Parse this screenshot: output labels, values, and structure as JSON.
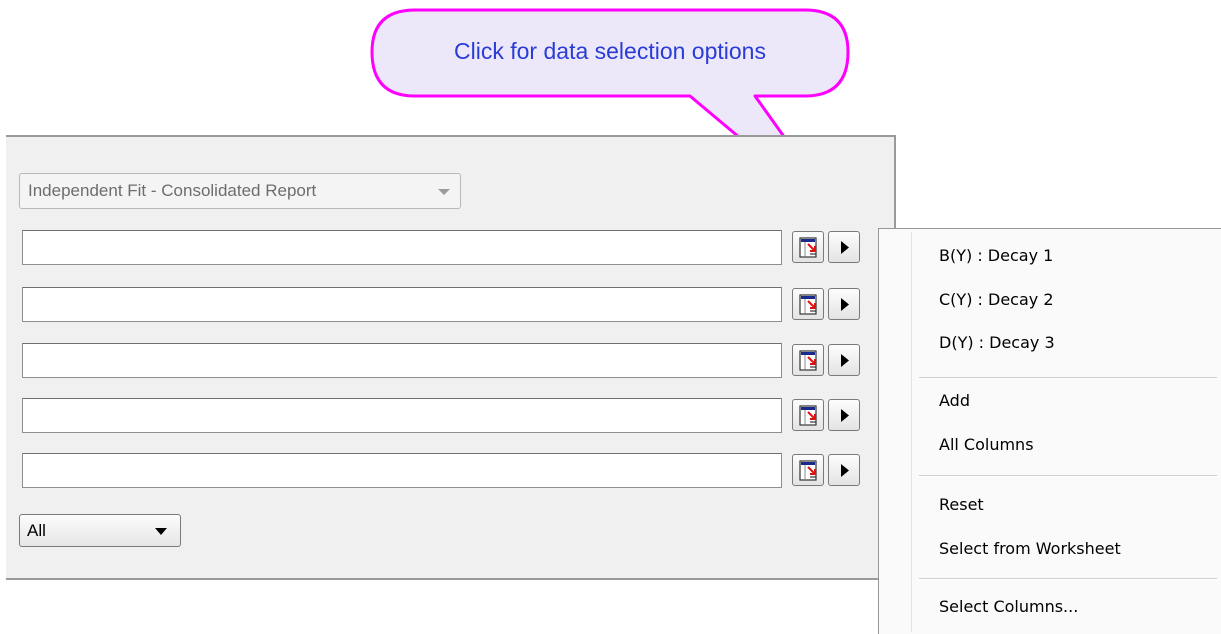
{
  "callout": {
    "text": "Click for data selection options",
    "outline_color": "#ff00ff",
    "text_color": "#2a3bd6"
  },
  "report_combo": {
    "value": "Independent Fit - Consolidated Report",
    "enabled": false
  },
  "data_rows": [
    {
      "value": "",
      "pick_icon": "worksheet-pick-icon",
      "menu_icon": "triangle-right-icon"
    },
    {
      "value": "",
      "pick_icon": "worksheet-pick-icon",
      "menu_icon": "triangle-right-icon"
    },
    {
      "value": "",
      "pick_icon": "worksheet-pick-icon",
      "menu_icon": "triangle-right-icon"
    },
    {
      "value": "",
      "pick_icon": "worksheet-pick-icon",
      "menu_icon": "triangle-right-icon"
    },
    {
      "value": "",
      "pick_icon": "worksheet-pick-icon",
      "menu_icon": "triangle-right-icon"
    }
  ],
  "range_combo": {
    "value": "All"
  },
  "context_menu": {
    "group1": [
      "B(Y) : Decay 1",
      "C(Y) : Decay 2",
      "D(Y) : Decay 3"
    ],
    "group2": [
      "Add",
      "All Columns"
    ],
    "group3": [
      "Reset",
      "Select from Worksheet"
    ],
    "group4": [
      "Select Columns..."
    ],
    "highlighted_item": "Select Columns...",
    "highlight_color": "#ff00ff"
  }
}
